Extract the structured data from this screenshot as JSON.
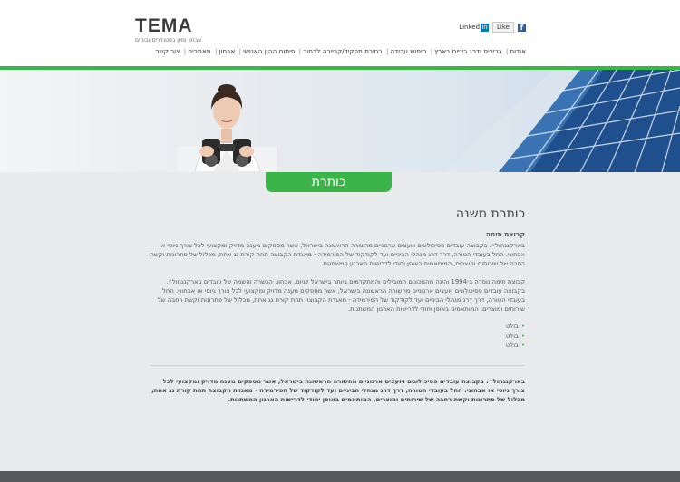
{
  "logo": {
    "name": "TEMA",
    "tagline": "אבחון ומיון בסטנדרים גבוהים"
  },
  "social": {
    "linkedin": "Linked",
    "linkedin_box": "in",
    "like": "Like",
    "facebook": "f"
  },
  "nav": [
    "אודות",
    "בכירים ודרג ביניים בארץ",
    "חיפוש עבודה",
    "בחירת תפקיד/קריירה לבחור",
    "פיתוח ההון האנושי",
    "אבחון",
    "מאמרים",
    "צור קשר"
  ],
  "page_tab": "כותרת",
  "content": {
    "heading": "כותרת משנה",
    "subheading": "קבוצת תימה",
    "para1": "בארקנגחול״. בקבוצה עובדים פסיכולוגים ויועצים ארגוניים מהשורה הראשונה בישראל, אשר מספקים מענה מדויק ומקצועי לכל צורך גיוסי או אבחוני. החל בעובדי הטורה, דרך דרג מנהלי הביניים ועד לקודקוד של הפירמידה - מאגדת הקבוצה תחת קורת גג אחת, מכלול של פתרונות וקשת רחבה של שירותים ומוצרים, המותאמים באופן יחודי לדרישות הארגון המשתנות.",
    "para2": "קבוצת תימה נוסדה ב-1994 והינה מהמכונים המובילים והמתקדמים ביותר בישראל לגיוס, אבחון, הכשרה והשמה של עובדים בארקנגחול״. בקבוצה עובדים פסיכולוגים ויועצים ארגוניים מהשורה הראשונה בישראל, אשר מספקים מענה מדויק ומקצועי לכל צורך גיוסי או אבחוני. החל בעובדי הטורה, דרך דרג מנהלי הביניים ועד לקודקוד של הפירמידה - מאגדת הקבוצה תחת קורת גג אחת, מכלול של פתרונות וקשת רחבה של שירותים ומוצרים, המותאמים באופן יחודי לדרישות הארגון המשתנות.",
    "bullets": [
      "בולט",
      "בולט",
      "בולט"
    ],
    "para3": "בארקנגחול״. בקבוצה עובדים פסיכולוגים ויועצים ארגוניים מהשורה הראשונה בישראל, אשר מספקים מענה מדויק ומקצועי לכל צורך גיוסי או אבחוני. החל בעובדי הטורה, דרך דרג מנהלי הביניים ועד לקודקוד של הפירמידה - מאגדת הקבוצה תחת קורת גג אחת, מכלול של פתרונות וקשת רחבה של שירותים ומוצרים, המותאמים באופן יחודי לדרישות הארגון המשתנות."
  },
  "colors": {
    "brand_green": "#3bb54a",
    "footer": "#57595b"
  }
}
